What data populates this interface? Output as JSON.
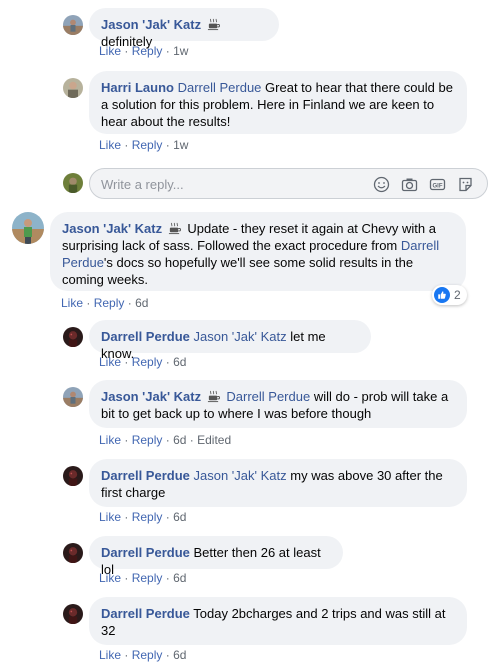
{
  "placeholders": {
    "reply": "Write a reply..."
  },
  "actions": {
    "like": "Like",
    "reply": "Reply",
    "sep": "·"
  },
  "comments": [
    {
      "author": "Jason 'Jak' Katz",
      "has_cup": true,
      "mention": "",
      "text": "definitely",
      "time": "1w",
      "edited": ""
    },
    {
      "author": "Harri Launo",
      "has_cup": false,
      "mention": "Darrell Perdue",
      "text": "Great to hear that there could be a solution for this problem. Here in Finland we are keen to hear about the results!",
      "time": "1w",
      "edited": ""
    },
    {
      "author": "Jason 'Jak' Katz",
      "has_cup": true,
      "mention": "",
      "text_a": "Update - they reset it again at Chevy with a surprising lack of sass. Followed the exact procedure from",
      "mention_inline": "Darrell Perdue",
      "text_b": "'s docs so hopefully we'll see some solid results in the coming weeks.",
      "time": "6d",
      "reaction_count": "2",
      "edited": ""
    },
    {
      "author": "Darrell Perdue",
      "has_cup": false,
      "mention": "Jason 'Jak' Katz",
      "text": "let me know.",
      "time": "6d",
      "edited": ""
    },
    {
      "author": "Jason 'Jak' Katz",
      "has_cup": true,
      "mention": "Darrell Perdue",
      "text": "will do - prob will take a bit to get back up to where I was before though",
      "time": "6d",
      "edited": "Edited"
    },
    {
      "author": "Darrell Perdue",
      "has_cup": false,
      "mention": "Jason 'Jak' Katz",
      "text": "my was above 30 after the first charge",
      "time": "6d",
      "edited": ""
    },
    {
      "author": "Darrell Perdue",
      "has_cup": false,
      "mention": "",
      "text": "Better then 26 at least lol",
      "time": "6d",
      "edited": ""
    },
    {
      "author": "Darrell Perdue",
      "has_cup": false,
      "mention": "",
      "text": "Today 2bcharges and 2 trips and was still at 32",
      "time": "6d",
      "edited": ""
    }
  ],
  "icons": {
    "cup": "coffee-cup-icon",
    "emoji": "emoji-icon",
    "camera": "camera-icon",
    "gif": "gif-icon",
    "sticker": "sticker-icon",
    "like_reaction": "like-reaction-icon"
  },
  "colors": {
    "link": "#385898",
    "action": "#4267b2",
    "bubble": "#f0f2f5",
    "like_blue": "#1877f2"
  }
}
